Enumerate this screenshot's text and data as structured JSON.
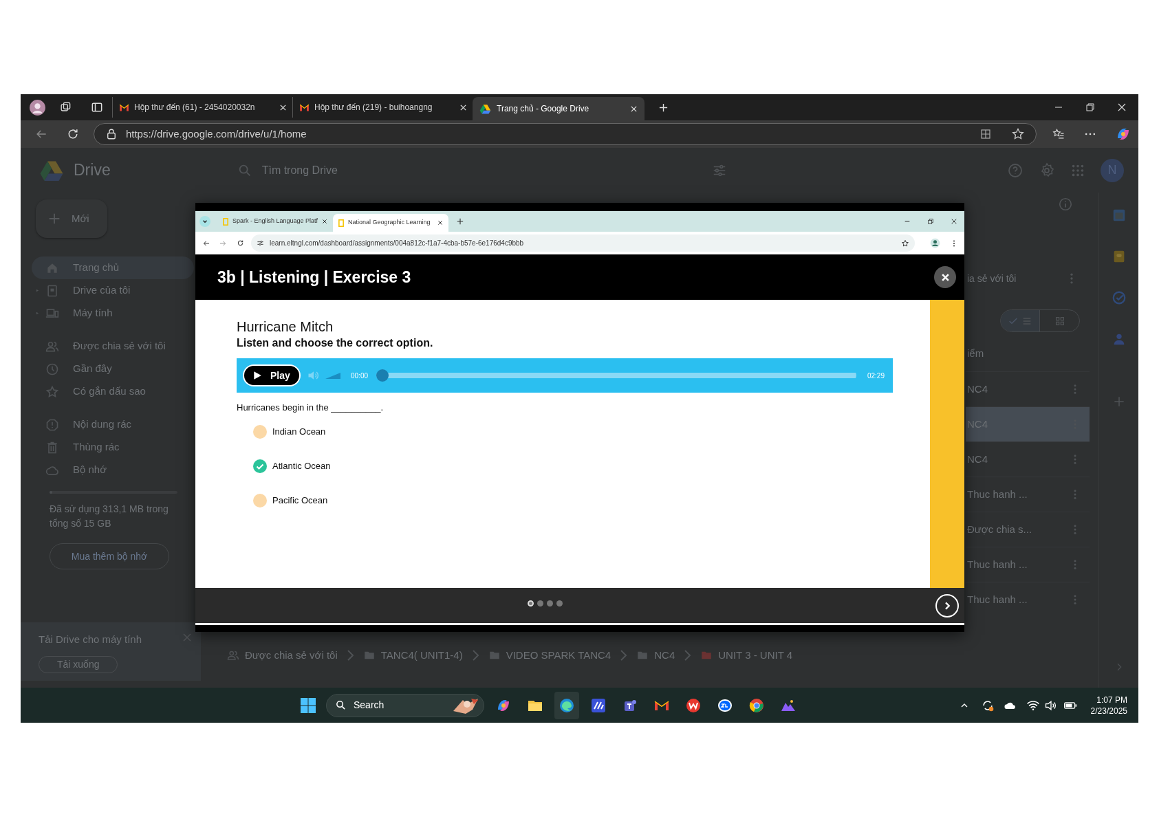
{
  "browser": {
    "tabs": [
      {
        "kind": "mail",
        "title": "Hộp thư đến (61) - 2454020032n",
        "selected": false
      },
      {
        "kind": "mail",
        "title": "Hộp thư đến (219) - buihoangng",
        "selected": false
      },
      {
        "kind": "drive",
        "title": "Trang chủ - Google Drive",
        "selected": true
      }
    ],
    "url": "https://drive.google.com/drive/u/1/home"
  },
  "drive": {
    "app_name": "Drive",
    "search_placeholder": "Tìm trong Drive",
    "avatar_letter": "N",
    "new_button": "Mới",
    "nav": [
      {
        "kind": "home",
        "label": "Trang chủ",
        "selected": true,
        "expandable": false
      },
      {
        "kind": "drive",
        "label": "Drive của tôi",
        "selected": false,
        "expandable": true
      },
      {
        "kind": "computer",
        "label": "Máy tính",
        "selected": false,
        "expandable": true
      },
      {
        "kind": "shared",
        "label": "Được chia sẻ với tôi",
        "selected": false,
        "expandable": false
      },
      {
        "kind": "recent",
        "label": "Gần đây",
        "selected": false,
        "expandable": false
      },
      {
        "kind": "starred",
        "label": "Có gắn dấu sao",
        "selected": false,
        "expandable": false
      },
      {
        "kind": "spam",
        "label": "Nội dung rác",
        "selected": false,
        "expandable": false
      },
      {
        "kind": "trash",
        "label": "Thùng rác",
        "selected": false,
        "expandable": false
      },
      {
        "kind": "storage",
        "label": "Bộ nhớ",
        "selected": false,
        "expandable": false
      }
    ],
    "storage": {
      "level": 0.02,
      "text": "Đã sử dụng 313,1 MB trong tổng số 15 GB",
      "button": "Mua thêm bộ nhớ"
    },
    "promo": {
      "title": "Tải Drive cho máy tính",
      "button": "Tải xuống"
    },
    "suggested_label": "ia sẻ với tôi",
    "column_header": "iểm",
    "view_toggle": [
      {
        "kind": "list",
        "selected": true
      },
      {
        "kind": "grid",
        "selected": false
      }
    ],
    "files": [
      {
        "name": "NC4",
        "selected": false
      },
      {
        "name": "NC4",
        "selected": true
      },
      {
        "name": "NC4",
        "selected": false
      },
      {
        "name": "Thuc hanh ...",
        "selected": false
      },
      {
        "name": "Được chia s...",
        "selected": false
      },
      {
        "name": "Thuc hanh ...",
        "selected": false
      },
      {
        "name": "Thuc hanh ...",
        "selected": false
      }
    ],
    "breadcrumb": [
      {
        "kind": "shared",
        "label": "Được chia sẻ với tôi"
      },
      {
        "kind": "folder",
        "label": "TANC4( UNIT1-4)"
      },
      {
        "kind": "folder",
        "label": "VIDEO SPARK TANC4"
      },
      {
        "kind": "folder",
        "label": "NC4"
      },
      {
        "kind": "colored_folder",
        "label": "UNIT 3 - UNIT 4"
      }
    ]
  },
  "viewer": {
    "tabs": [
      {
        "title": "Spark - English Language Platf",
        "selected": false
      },
      {
        "title": "National Geographic Learning",
        "selected": true
      }
    ],
    "url": "learn.eltngl.com/dashboard/assignments/004a812c-f1a7-4cba-b57e-6e176d4c9bbb",
    "title": "3b | Listening | Exercise 3",
    "heading": "Hurricane Mitch",
    "instruction": "Listen and choose the correct option.",
    "audio": {
      "button": "Play",
      "elapsed": "00:00",
      "duration": "02:29",
      "level": 0
    },
    "question": "Hurricanes begin in the __________.",
    "options": [
      {
        "label": "Indian Ocean",
        "selected": false
      },
      {
        "label": "Atlantic Ocean",
        "selected": true
      },
      {
        "label": "Pacific Ocean",
        "selected": false
      }
    ],
    "pages": [
      {
        "selected": true
      },
      {
        "selected": false
      },
      {
        "selected": false
      },
      {
        "selected": false
      }
    ]
  },
  "taskbar": {
    "search": "Search",
    "time": "1:07 PM",
    "date": "2/23/2025"
  }
}
